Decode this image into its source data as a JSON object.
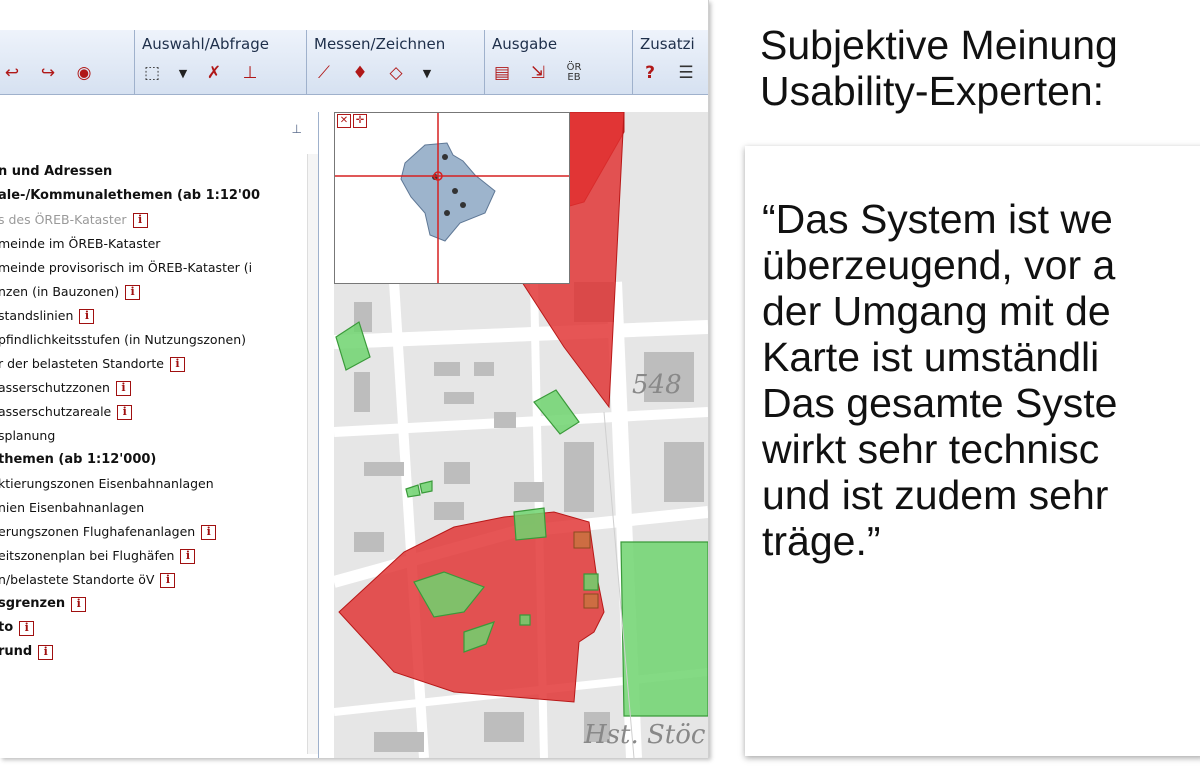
{
  "toolbar": {
    "groups": [
      {
        "title": ""
      },
      {
        "title": "Auswahl/Abfrage"
      },
      {
        "title": "Messen/Zeichnen"
      },
      {
        "title": "Ausgabe"
      },
      {
        "title": "Zusatzi"
      }
    ]
  },
  "layers": {
    "items": [
      {
        "label": "n und Adressen",
        "style": "bold"
      },
      {
        "label": "ale-/Kommunalethemen (ab 1:12'00",
        "style": "bold"
      },
      {
        "label": "s des ÖREB-Kataster",
        "style": "grey",
        "info": "i"
      },
      {
        "label": "meinde im ÖREB-Kataster",
        "style": "normal"
      },
      {
        "label": "meinde provisorisch im ÖREB-Kataster (i",
        "style": "normal"
      },
      {
        "label": "nzen (in Bauzonen)",
        "style": "normal",
        "info": "i"
      },
      {
        "label": "standslinien",
        "style": "normal",
        "info": "i"
      },
      {
        "label": "pfindlichkeitsstufen (in Nutzungszonen)",
        "style": "normal"
      },
      {
        "label": "r der belasteten Standorte",
        "style": "normal",
        "info": "i"
      },
      {
        "label": "asserschutzzonen",
        "style": "normal",
        "info": "i"
      },
      {
        "label": "asserschutzareale",
        "style": "normal",
        "info": "i"
      },
      {
        "label": "splanung",
        "style": "normal"
      },
      {
        "label": "themen (ab 1:12'000)",
        "style": "bold"
      },
      {
        "label": "ktierungszonen Eisenbahnanlagen",
        "style": "normal"
      },
      {
        "label": "nien Eisenbahnanlagen",
        "style": "normal"
      },
      {
        "label": "erungszonen Flughafenanlagen",
        "style": "normal",
        "info": "i"
      },
      {
        "label": "eitszonenplan bei Flughäfen",
        "style": "normal",
        "info": "i"
      },
      {
        "label": "n/belastete Standorte öV",
        "style": "normal",
        "info": "i"
      },
      {
        "label": "sgrenzen",
        "style": "bold",
        "info": "i"
      },
      {
        "label": "to",
        "style": "bold",
        "info": "i"
      },
      {
        "label": "rund",
        "style": "bold",
        "info": "i"
      }
    ]
  },
  "map": {
    "elevation_label": "548",
    "station_label": "Hst. Stöc",
    "overlay_colors": {
      "contaminated": "#e03030",
      "green_area": "#6fd36f"
    }
  },
  "slide": {
    "heading_line1": "Subjektive Meinung",
    "heading_line2": "Usability-Experten:",
    "quote_lines": [
      "“Das System ist we",
      "überzeugend, vor a",
      "der Umgang mit de",
      "Karte ist umständli",
      "Das gesamte Syste",
      "wirkt sehr technisc",
      "und ist zudem sehr",
      "träge.”"
    ]
  }
}
